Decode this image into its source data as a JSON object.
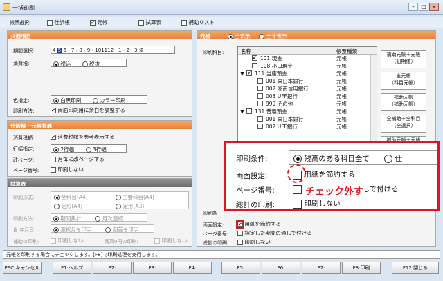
{
  "window": {
    "title": "一括印刷"
  },
  "top": {
    "select_label": "帳票選択:",
    "options": [
      {
        "label": "仕訳帳",
        "checked": false
      },
      {
        "label": "元帳",
        "checked": true
      },
      {
        "label": "試算表",
        "checked": false
      },
      {
        "label": "補助リスト",
        "checked": false
      }
    ]
  },
  "common": {
    "header": "共通項目",
    "period_label": "期間選択:",
    "months": [
      "4",
      "5",
      "6",
      "・",
      "7",
      "・",
      "8",
      "・",
      "9",
      "・",
      "10",
      "11",
      "12",
      "・",
      "1",
      "・",
      "2",
      "・",
      "3",
      "決"
    ],
    "tax_label": "消費税:",
    "tax_opts": [
      "税込",
      "税抜"
    ],
    "color_label": "色指定:",
    "color_opts": [
      "白黒印刷",
      "カラー印刷"
    ],
    "method_label": "印刷方法:",
    "method_opt": "両面印刷用に余白を調整する"
  },
  "journal": {
    "header": "仕訳帳・元帳共通",
    "tax_label": "消費税額:",
    "tax_opt": "消費税額を参考表示する",
    "row_label": "行幅指定:",
    "row_opts": [
      "2行幅",
      "3行幅"
    ],
    "page_break_label": "改ページ:",
    "page_break_opt": "月毎に改ページする",
    "page_num_label": "ページ番号:",
    "page_num_opt": "印刷しない"
  },
  "trial": {
    "header": "試算表",
    "form_label": "印刷形式:",
    "form_opts": [
      "全科目(A4)",
      "主要科目(A4)",
      "定形(A4)",
      "定形(A3)"
    ],
    "method_label": "印刷方法:",
    "method_opts": [
      "期間集計",
      "月次連続"
    ],
    "year_label": "自 年月日",
    "year_opts": [
      "選択月を印字",
      "期首を印字"
    ],
    "aux_label": "補助の印刷:",
    "aux_opt": "印刷しない",
    "zero_label": "残高0円の印刷:",
    "zero_opt": "印刷しない"
  },
  "ledger": {
    "header": "元帳",
    "view_opts": [
      "全表示",
      "全非表示"
    ],
    "subject_label": "印刷科目:",
    "col_name": "名称",
    "col_type": "帳票種類",
    "rows": [
      {
        "prefix": "",
        "name": "101 現金",
        "type": "元帳",
        "checked": true,
        "indent": 1
      },
      {
        "prefix": "",
        "name": "108 小口現金",
        "type": "元帳",
        "checked": false,
        "indent": 1
      },
      {
        "prefix": "▼",
        "name": "111 当座預金",
        "type": "元帳",
        "checked": true,
        "indent": 0
      },
      {
        "prefix": "",
        "name": "001 東日本銀行",
        "type": "元帳",
        "checked": false,
        "indent": 2
      },
      {
        "prefix": "",
        "name": "002 湖南信用銀行",
        "type": "元帳",
        "checked": false,
        "indent": 2
      },
      {
        "prefix": "",
        "name": "003 UFF銀行",
        "type": "元帳",
        "checked": false,
        "indent": 2
      },
      {
        "prefix": "",
        "name": "999 その他",
        "type": "元帳",
        "checked": false,
        "indent": 2
      },
      {
        "prefix": "▼",
        "name": "131 普通預金",
        "type": "元帳",
        "checked": false,
        "indent": 0
      },
      {
        "prefix": "",
        "name": "001 東日本銀行",
        "type": "元帳",
        "checked": false,
        "indent": 2
      },
      {
        "prefix": "",
        "name": "002 UFF銀行",
        "type": "元帳",
        "checked": false,
        "indent": 2
      }
    ],
    "side_buttons": [
      "補助元帳＋元帳\n（初期値）",
      "全元帳\n（科目元帳）",
      "補助元帳\n（補助元帳）",
      "全補助＋全科目\n（全選択）",
      "補助元帳＋元帳"
    ],
    "print_cond_label": "印刷条",
    "duplex_label": "両面設定:",
    "duplex_opt": "用紙を節約する",
    "page_label": "ページ番号:",
    "page_opt": "指定した期間の通しで付ける",
    "total_label": "総計の印刷:",
    "total_opt": "印刷しない"
  },
  "zoom": {
    "cond_label": "印刷条件:",
    "cond_opt1": "残高のある科目全て",
    "cond_opt2": "仕",
    "duplex_label": "両面設定:",
    "duplex_opt": "用紙を節約する",
    "page_label": "ページ番号:",
    "page_opt": "指定した期間の通しで付ける",
    "total_label": "総計の印刷:",
    "total_opt": "印刷しない",
    "annotation": "チェック外す"
  },
  "status": "元帳を印刷する場合にチェックします。[F8]で印刷処理を実行します。",
  "fkeys": [
    "ESC:キャンセル",
    "F1:ヘルプ",
    "F2:",
    "F3:",
    "F4:",
    "F5:",
    "F6:",
    "F7:",
    "F8:印刷",
    "F12:閉じる"
  ]
}
